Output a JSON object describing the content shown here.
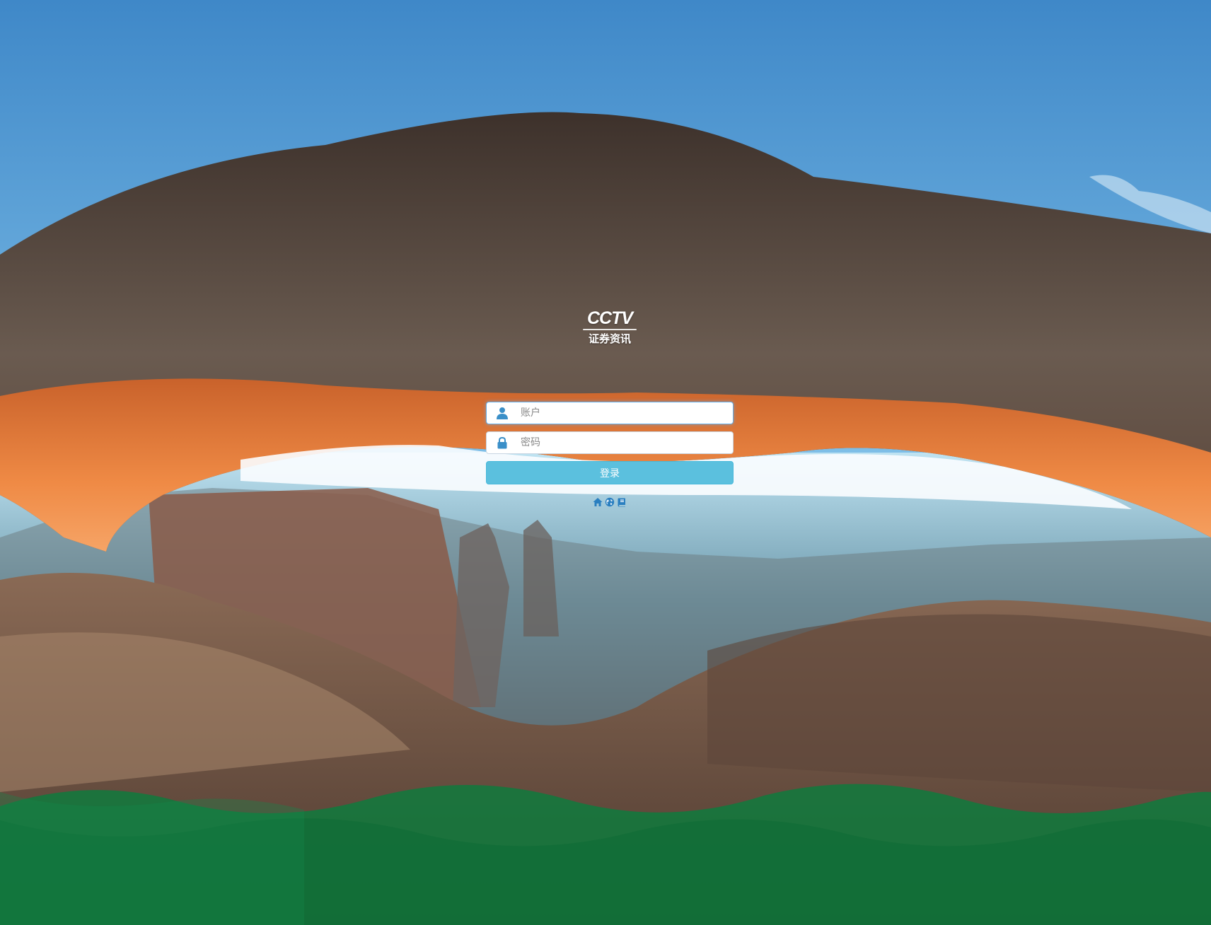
{
  "logo": {
    "mark": "CCTV",
    "subtitle": "证券资讯"
  },
  "login": {
    "username_placeholder": "账户",
    "username_value": "",
    "password_placeholder": "密码",
    "password_value": "",
    "submit_label": "登录"
  },
  "links": [
    {
      "icon": "home-icon"
    },
    {
      "icon": "globe-icon"
    },
    {
      "icon": "book-icon"
    }
  ],
  "colors": {
    "button": "#5bc0de",
    "icon": "#3a8fc8",
    "waves": "#0f7a3d"
  }
}
